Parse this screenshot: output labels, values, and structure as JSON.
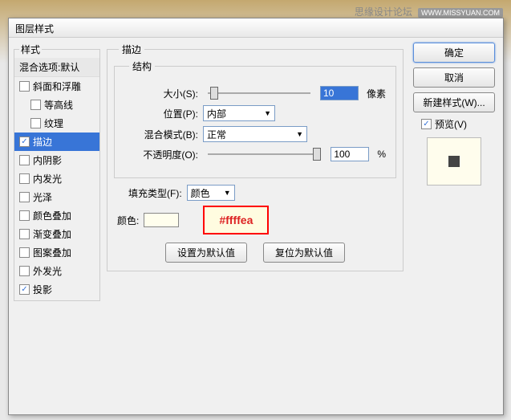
{
  "watermark": {
    "text": "思缘设计论坛",
    "url": "WWW.MISSYUAN.COM"
  },
  "dialog_title": "图层样式",
  "styles_legend": "样式",
  "blend_header": "混合选项:默认",
  "style_items": [
    {
      "label": "斜面和浮雕",
      "checked": false,
      "indent": false
    },
    {
      "label": "等高线",
      "checked": false,
      "indent": true
    },
    {
      "label": "纹理",
      "checked": false,
      "indent": true
    },
    {
      "label": "描边",
      "checked": true,
      "indent": false,
      "selected": true
    },
    {
      "label": "内阴影",
      "checked": false,
      "indent": false
    },
    {
      "label": "内发光",
      "checked": false,
      "indent": false
    },
    {
      "label": "光泽",
      "checked": false,
      "indent": false
    },
    {
      "label": "颜色叠加",
      "checked": false,
      "indent": false
    },
    {
      "label": "渐变叠加",
      "checked": false,
      "indent": false
    },
    {
      "label": "图案叠加",
      "checked": false,
      "indent": false
    },
    {
      "label": "外发光",
      "checked": false,
      "indent": false
    },
    {
      "label": "投影",
      "checked": true,
      "indent": false
    }
  ],
  "stroke_legend": "描边",
  "structure_legend": "结构",
  "size": {
    "label": "大小(S):",
    "value": "10",
    "unit": "像素"
  },
  "position": {
    "label": "位置(P):",
    "value": "内部"
  },
  "blend_mode": {
    "label": "混合模式(B):",
    "value": "正常"
  },
  "opacity": {
    "label": "不透明度(O):",
    "value": "100",
    "unit": "%"
  },
  "fill_type": {
    "label": "填充类型(F):",
    "value": "颜色"
  },
  "color_label": "颜色:",
  "color_hex": "#ffffea",
  "btn_default": "设置为默认值",
  "btn_reset": "复位为默认值",
  "right": {
    "ok": "确定",
    "cancel": "取消",
    "new_style": "新建样式(W)...",
    "preview": "预览(V)"
  }
}
